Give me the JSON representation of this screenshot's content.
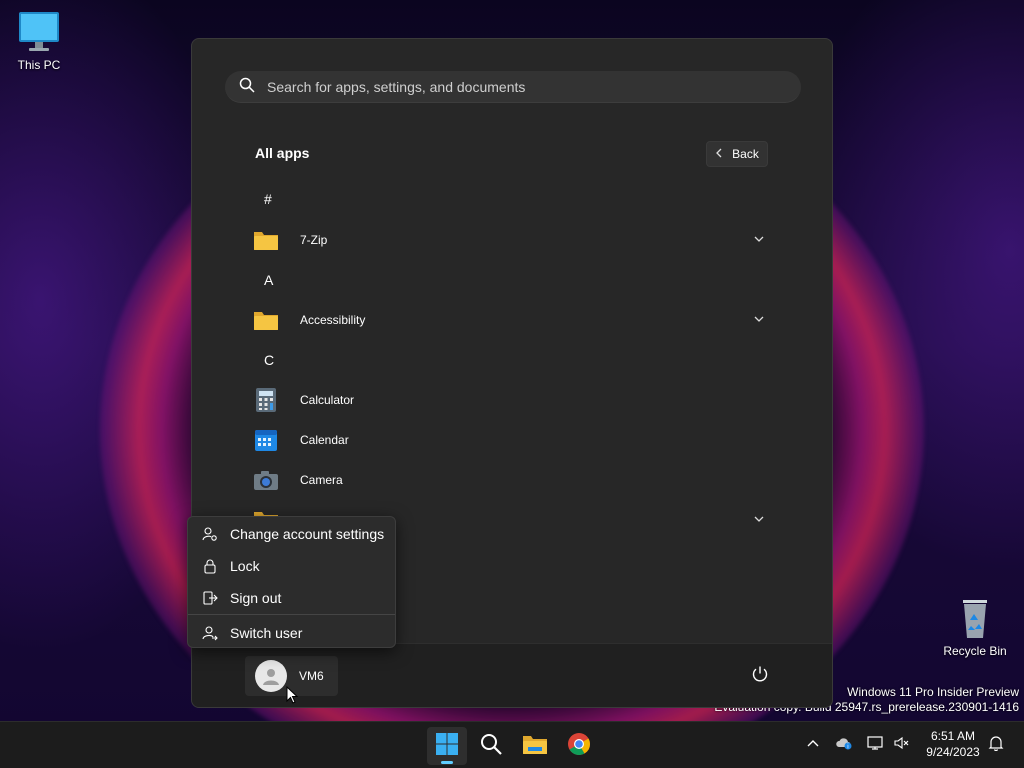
{
  "desktop": {
    "icons": [
      {
        "label": "This PC",
        "icon": "monitor-icon"
      },
      {
        "label": "Recycle Bin",
        "icon": "recycle-bin-icon"
      }
    ],
    "watermark": {
      "line1": "Windows 11 Pro Insider Preview",
      "line2": "Evaluation copy. Build 25947.rs_prerelease.230901-1416"
    }
  },
  "start_menu": {
    "search_placeholder": "Search for apps, settings, and documents",
    "title": "All apps",
    "back_label": "Back",
    "groups": [
      {
        "letter": "#"
      },
      {
        "letter": "A"
      },
      {
        "letter": "C"
      }
    ],
    "apps": [
      {
        "name": "7-Zip",
        "icon": "folder-icon",
        "expandable": true
      },
      {
        "name": "Accessibility",
        "icon": "folder-icon",
        "expandable": true
      },
      {
        "name": "Calculator",
        "icon": "calculator-icon",
        "expandable": false
      },
      {
        "name": "Calendar",
        "icon": "calendar-icon",
        "expandable": false
      },
      {
        "name": "Camera",
        "icon": "camera-icon",
        "expandable": false
      }
    ],
    "user": {
      "name": "VM6"
    }
  },
  "account_menu": {
    "items": [
      {
        "label": "Change account settings",
        "icon": "account-settings-icon"
      },
      {
        "label": "Lock",
        "icon": "lock-icon"
      },
      {
        "label": "Sign out",
        "icon": "sign-out-icon"
      },
      {
        "label": "Switch user",
        "icon": "switch-user-icon"
      }
    ]
  },
  "taskbar": {
    "pinned": [
      "windows-start-icon",
      "search-icon",
      "file-explorer-icon",
      "chrome-icon"
    ],
    "tray": [
      "chevron-up-icon",
      "onedrive-icon",
      "network-icon",
      "volume-muted-icon",
      "notification-bell-icon"
    ],
    "time": "6:51 AM",
    "date": "9/24/2023"
  },
  "colors": {
    "accent": "#60cdff",
    "start_bg": "#272727",
    "folder": "#f5c542"
  }
}
